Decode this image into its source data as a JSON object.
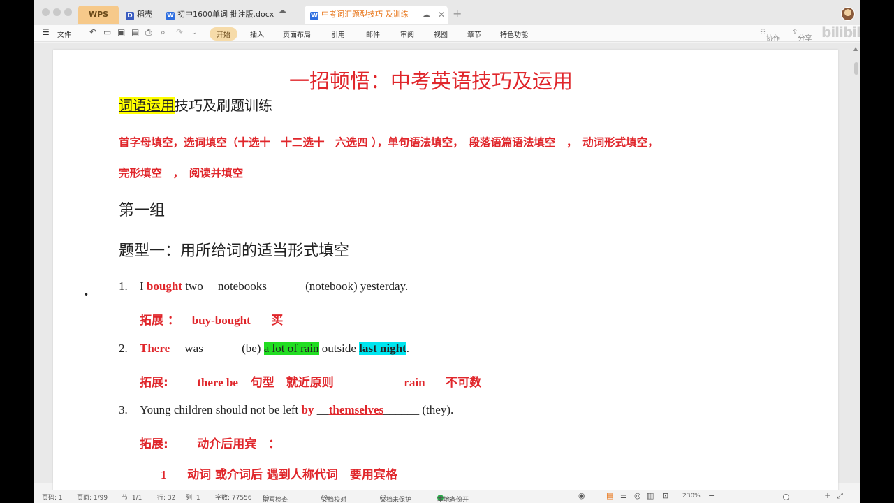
{
  "tabs": {
    "wps": "WPS",
    "daoke": "稻壳",
    "doc1": "初中1600单词 批注版.docx",
    "doc2": "中考词汇题型技巧 及训练",
    "add": "+"
  },
  "menu": {
    "file": "文件",
    "start": "开始",
    "insert": "插入",
    "layout": "页面布局",
    "ref": "引用",
    "mail": "邮件",
    "review": "审阅",
    "view": "视图",
    "section": "章节",
    "features": "特色功能",
    "collab": "协作",
    "share": "分享"
  },
  "watermark": "bilibili",
  "doc": {
    "title": "一招顿悟：中考英语技巧及运用",
    "subtitle_hl": "词语运用",
    "subtitle_rest": "技巧及刷题训练",
    "types_line1": "首字母填空，选词填空（十选十　十二选十　六选四 ），单句语法填空，　段落语篇语法填空　，　动词形式填空，",
    "types_line2": "完形填空　，　阅读并填空",
    "group": "第一组",
    "type_heading": "题型一：用所给词的适当形式填空",
    "q1": {
      "num": "1.",
      "p1": "I ",
      "red": "bought",
      "p2": " two __",
      "answer": "notebooks",
      "p3": "______ (notebook) yesterday."
    },
    "ext1": {
      "label": "拓展 ：",
      "en": "buy-bought",
      "cn": "买"
    },
    "q2": {
      "num": "2.",
      "red": "There",
      "p1": " __",
      "answer": "was",
      "p2": "______ (be) ",
      "green": "a lot of rain",
      "p3": " outside ",
      "cyan": "last night",
      "p4": "."
    },
    "ext2": {
      "label": "拓展:",
      "en1": "there be",
      "cn1": "句型　就近原则",
      "en2": "rain",
      "cn2": "不可数"
    },
    "q3": {
      "num": "3.",
      "p1": "Young children should not be left ",
      "red": "by",
      "p2": " __",
      "answer": "themselves",
      "p3": "______ (they)."
    },
    "ext3": {
      "label": "拓展:",
      "cn": "动介后用宾　："
    },
    "rule1": {
      "num": "1",
      "text": "动词 或介词后 遇到人称代词　要用宾格"
    }
  },
  "status": {
    "page_no": "页码: 1",
    "pages": "页面: 1/99",
    "section": "节: 1/1",
    "row": "行: 32",
    "col": "列: 1",
    "words": "字数: 77556",
    "spell": "拼写检查",
    "proof": "文档校对",
    "unprotected": "文档未保护",
    "backup": "本地备份开",
    "zoom": "230%"
  }
}
